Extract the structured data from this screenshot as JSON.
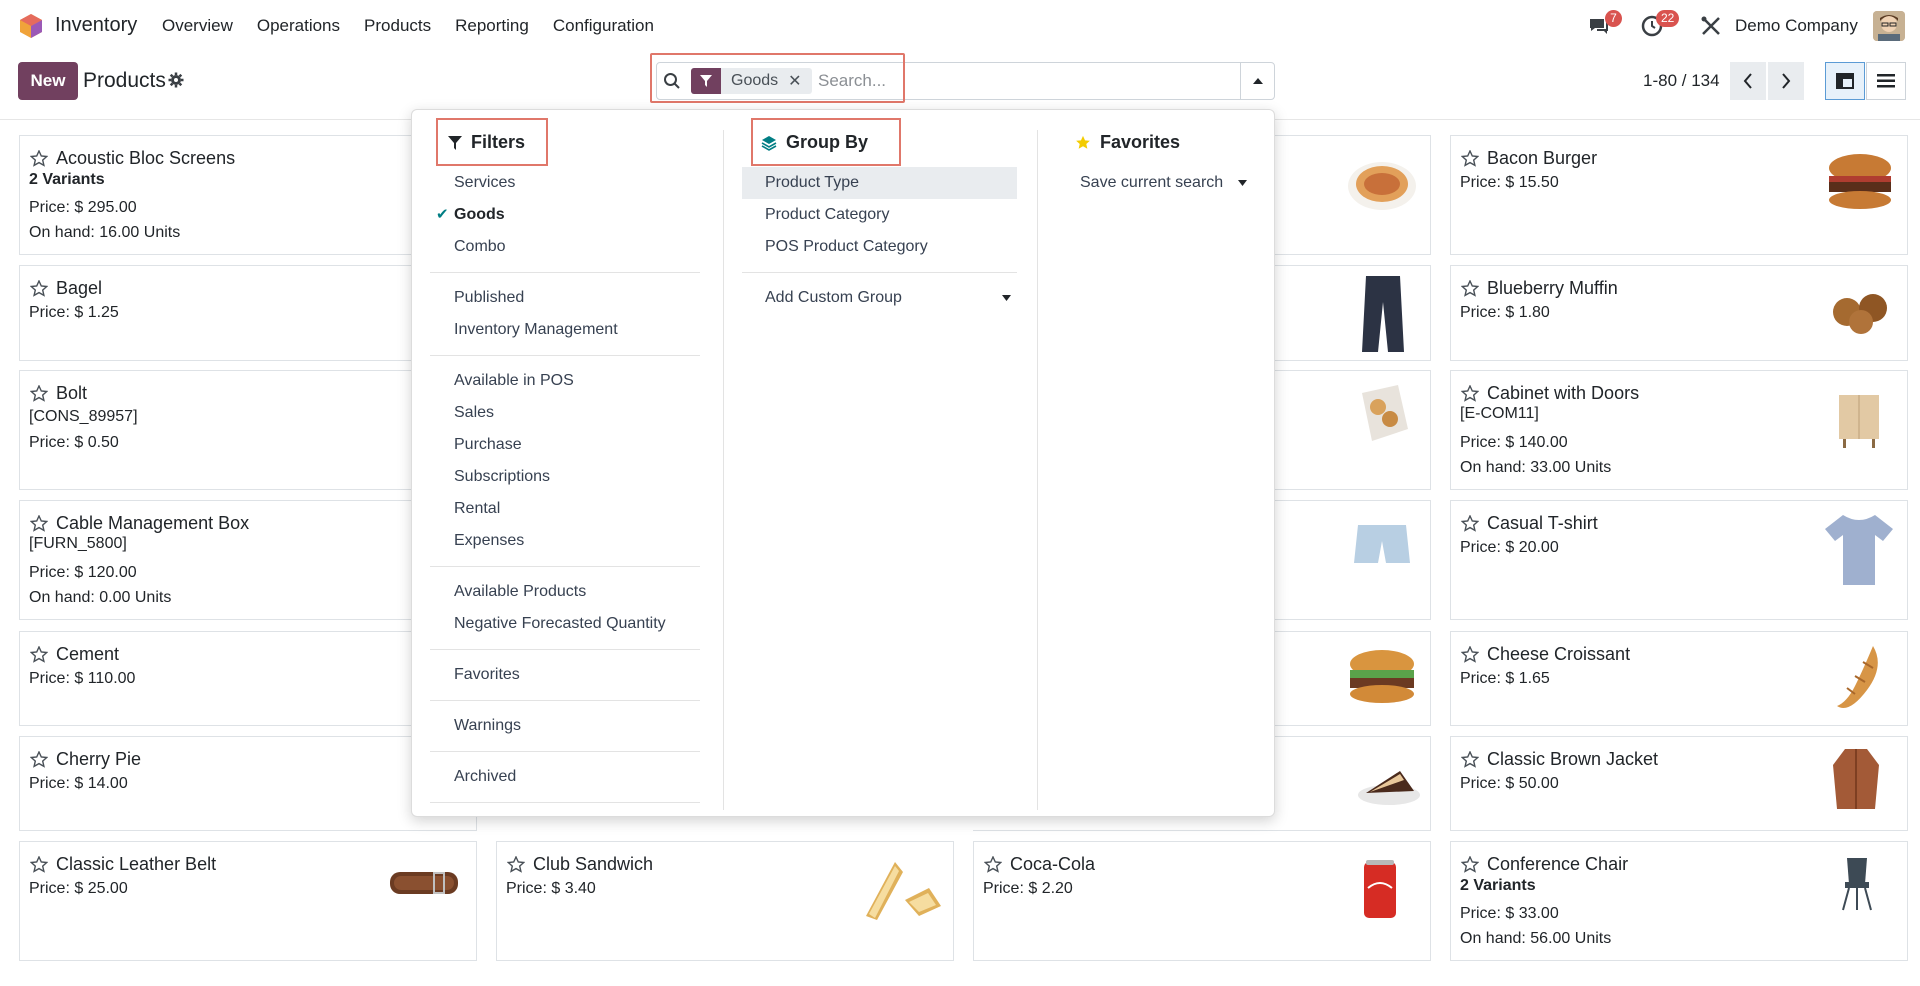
{
  "app": {
    "name": "Inventory"
  },
  "menu": [
    "Overview",
    "Operations",
    "Products",
    "Reporting",
    "Configuration"
  ],
  "nav": {
    "messages_count": "7",
    "activities_count": "22",
    "company": "Demo Company"
  },
  "control": {
    "new_label": "New",
    "title": "Products",
    "facet_label": "Goods",
    "search_placeholder": "Search...",
    "pager": "1-80 / 134"
  },
  "dropdown": {
    "filters": {
      "title": "Filters",
      "groups": [
        [
          "Services",
          "Goods",
          "Combo"
        ],
        [
          "Published",
          "Inventory Management"
        ],
        [
          "Available in POS",
          "Sales",
          "Purchase",
          "Subscriptions",
          "Rental",
          "Expenses"
        ],
        [
          "Available Products",
          "Negative Forecasted Quantity"
        ],
        [
          "Favorites"
        ],
        [
          "Warnings"
        ],
        [
          "Archived"
        ]
      ],
      "checked": "Goods"
    },
    "groupby": {
      "title": "Group By",
      "items": [
        "Product Type",
        "Product Category",
        "POS Product Category"
      ],
      "custom": "Add Custom Group"
    },
    "favorites": {
      "title": "Favorites",
      "save": "Save current search"
    }
  },
  "cards": {
    "col1": [
      {
        "name": "Acoustic Bloc Screens",
        "lines": [
          "2 Variants",
          "Price: $ 295.00",
          "On hand: 16.00 Units"
        ],
        "bold_first": true
      },
      {
        "name": "Bagel",
        "lines": [
          "Price: $ 1.25"
        ]
      },
      {
        "name": "Bolt",
        "lines": [
          "[CONS_89957]",
          "Price: $ 0.50"
        ]
      },
      {
        "name": "Cable Management Box",
        "lines": [
          "[FURN_5800]",
          "Price: $ 120.00",
          "On hand: 0.00 Units"
        ]
      },
      {
        "name": "Cement",
        "lines": [
          "Price: $ 110.00"
        ]
      },
      {
        "name": "Cherry Pie",
        "lines": [
          "Price: $ 14.00"
        ]
      },
      {
        "name": "Classic Leather Belt",
        "lines": [
          "Price: $ 25.00"
        ]
      }
    ],
    "col4": [
      {
        "name": "Bacon Burger",
        "lines": [
          "Price: $ 15.50"
        ]
      },
      {
        "name": "Blueberry Muffin",
        "lines": [
          "Price: $ 1.80"
        ]
      },
      {
        "name": "Cabinet with Doors",
        "lines": [
          "[E-COM11]",
          "Price: $ 140.00",
          "On hand: 33.00 Units"
        ]
      },
      {
        "name": "Casual T-shirt",
        "lines": [
          "Price: $ 20.00"
        ]
      },
      {
        "name": "Cheese Croissant",
        "lines": [
          "Price: $ 1.65"
        ]
      },
      {
        "name": "Classic Brown Jacket",
        "lines": [
          "Price: $ 50.00"
        ]
      },
      {
        "name": "Conference Chair",
        "lines": [
          "2 Variants",
          "Price: $ 33.00",
          "On hand: 56.00 Units"
        ],
        "bold_first": true
      }
    ],
    "bottom": [
      {
        "name": "Club Sandwich",
        "lines": [
          "Price: $ 3.40"
        ]
      },
      {
        "name": "Coca-Cola",
        "lines": [
          "Price: $ 2.20"
        ]
      }
    ]
  }
}
